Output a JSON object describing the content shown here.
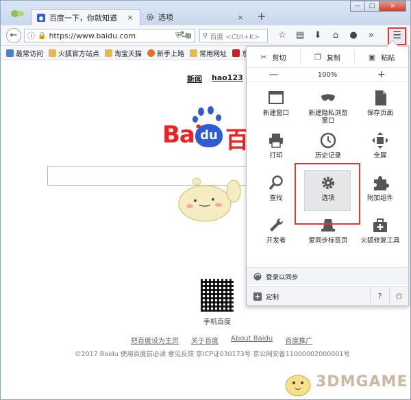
{
  "tabs": [
    {
      "title": "百度一下，你就知道",
      "active": true
    },
    {
      "title": "选项",
      "active": false
    }
  ],
  "window_buttons": {
    "minimize": "—",
    "maximize": "□",
    "close": "×"
  },
  "navbar": {
    "url": "https://www.baidu.com",
    "search_placeholder": "百度 <Ctrl+K>"
  },
  "bookmarks": [
    {
      "label": "最常访问",
      "color": "#4a7fc9"
    },
    {
      "label": "火狐官方站点",
      "color": "#e8b84a"
    },
    {
      "label": "淘宝天猫",
      "color": "#e8b84a"
    },
    {
      "label": "新手上路",
      "color": "#e76f2a"
    },
    {
      "label": "常用网址",
      "color": "#e8b84a"
    },
    {
      "label": "京东",
      "color": "#d01e1e"
    }
  ],
  "page": {
    "top_links": [
      "新闻",
      "hao123"
    ],
    "logo": {
      "left": "Bai",
      "middle": "du",
      "right": "百"
    },
    "qr_label": "手机百度",
    "footer_links": [
      "把百度设为主页",
      "关于百度",
      "About Baidu",
      "百度推广"
    ],
    "copyright": "©2017 Baidu 使用百度前必读 意见反馈 京ICP证030173号 京公网安备11000002000001号",
    "watermark": "3DMGAME"
  },
  "menu": {
    "edit": [
      {
        "label": "剪切",
        "icon": "scissors-icon"
      },
      {
        "label": "复制",
        "icon": "copy-icon"
      },
      {
        "label": "粘贴",
        "icon": "paste-icon"
      }
    ],
    "zoom": {
      "minus": "—",
      "level": "100%",
      "plus": "+"
    },
    "items": [
      {
        "label": "新建窗口",
        "icon": "new-window-icon"
      },
      {
        "label": "新建隐私浏览",
        "label2": "窗口",
        "icon": "private-mask-icon"
      },
      {
        "label": "保存页面",
        "icon": "save-page-icon"
      },
      {
        "label": "打印",
        "icon": "printer-icon"
      },
      {
        "label": "历史记录",
        "icon": "history-clock-icon"
      },
      {
        "label": "全屏",
        "icon": "fullscreen-icon"
      },
      {
        "label": "查找",
        "icon": "find-magnifier-icon"
      },
      {
        "label": "选项",
        "icon": "options-gear-icon",
        "selected": true
      },
      {
        "label": "附加组件",
        "icon": "addons-puzzle-icon"
      },
      {
        "label": "开发者",
        "icon": "developer-wrench-icon"
      },
      {
        "label": "爱同步标签页",
        "icon": "sync-tabs-icon"
      },
      {
        "label": "火狐修复工具",
        "icon": "repair-toolbox-icon"
      }
    ],
    "sync": "登录以同步",
    "customize": "定制",
    "help_symbol": "?",
    "quit_symbol": "⏻"
  }
}
